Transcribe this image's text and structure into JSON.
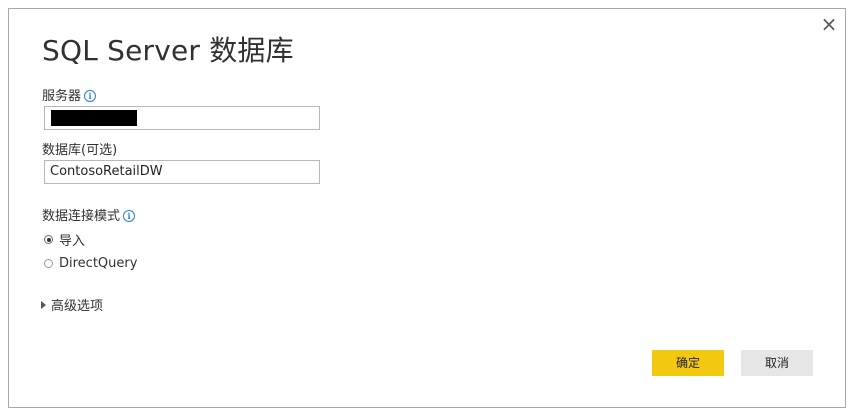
{
  "dialog": {
    "title": "SQL Server 数据库",
    "close_glyph": "×"
  },
  "server": {
    "label": "服务器",
    "value": ""
  },
  "database": {
    "label": "数据库(可选)",
    "value": "ContosoRetailDW"
  },
  "connectivity": {
    "label": "数据连接模式",
    "options": [
      {
        "label": "导入",
        "selected": true
      },
      {
        "label": "DirectQuery",
        "selected": false
      }
    ]
  },
  "advanced": {
    "label": "高级选项"
  },
  "buttons": {
    "ok": "确定",
    "cancel": "取消"
  },
  "icons": {
    "info": "i"
  },
  "colors": {
    "primary_button": "#f2c811",
    "secondary_button": "#e6e6e6",
    "info_icon": "#2b7cd3"
  }
}
